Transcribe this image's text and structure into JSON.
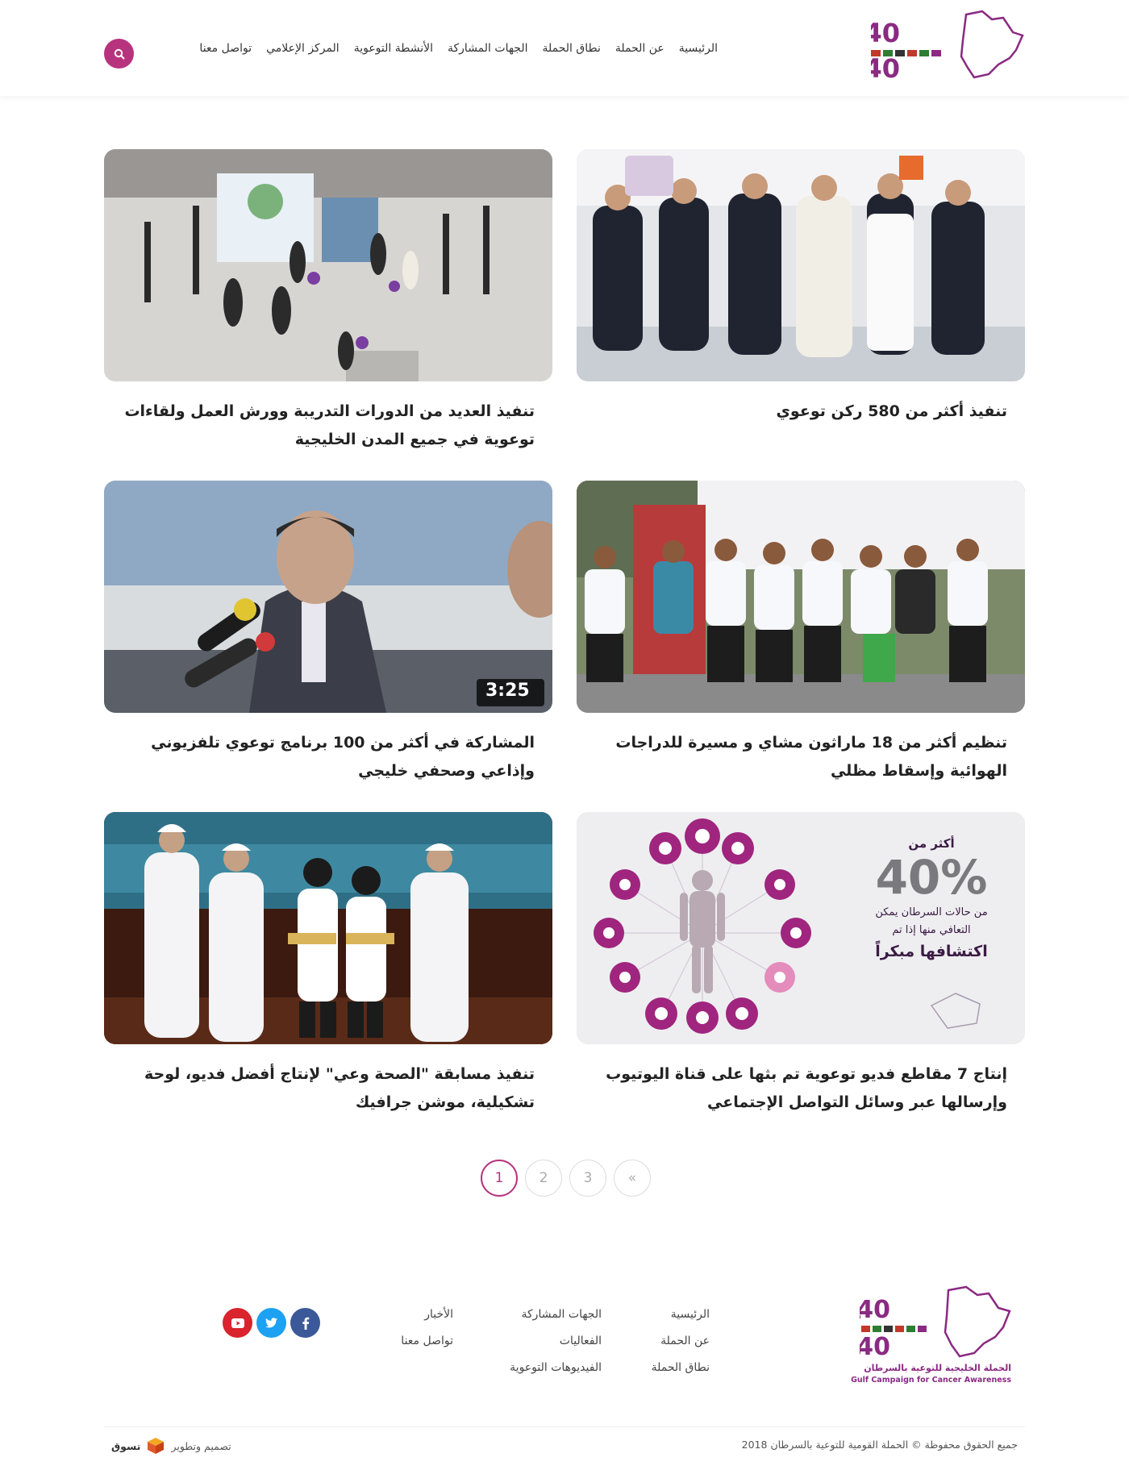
{
  "header": {
    "logo_alt": "40 وقاية 40 شفاء",
    "nav": [
      "الرئيسية",
      "عن الحملة",
      "نطاق الحملة",
      "الجهات المشاركة",
      "الأنشطة التوعوية",
      "المركز الإعلامي",
      "تواصل معنا"
    ]
  },
  "cards": [
    {
      "title": "تنفيذ أكثر من 580 ركن توعوي"
    },
    {
      "title": "تنفيذ العديد من الدورات التدريبة وورش العمل ولقاءات توعوية في جميع المدن الخليجية"
    },
    {
      "title": "تنظيم أكثر من 18 ماراثون مشاي و مسيرة للدراجات الهوائية وإسقاط مظلي"
    },
    {
      "title": "المشاركة في أكثر من 100 برنامج توعوي تلفزيوني وإذاعي وصحفي خليجي",
      "video_duration": "3:25"
    },
    {
      "title": "إنتاج 7 مقاطع فديو توعوية تم بثها على قناة اليوتيوب وإرسالها عبر وسائل التواصل الإجتماعي",
      "infographic": {
        "line1": "أكثر من",
        "percent": "40%",
        "line2": "من حالات السرطان يمكن",
        "line3": "التعافي منها إذا تم",
        "line4": "اكتشافها مبكراً"
      }
    },
    {
      "title": "تنفيذ مسابقة \"الصحة وعي\" لإنتاج أفضل فديو، لوحة تشكيلية، موشن جرافيك"
    }
  ],
  "pagination": {
    "pages": [
      "1",
      "2",
      "3"
    ],
    "next": "»",
    "active": "1"
  },
  "footer": {
    "logo_ar": "الحملة الخليجية للتوعية بالسرطان",
    "logo_en": "Gulf Campaign for Cancer Awareness",
    "col1": [
      "الرئيسية",
      "عن الحملة",
      "نطاق الحملة"
    ],
    "col2": [
      "الجهات المشاركة",
      "الفعاليات",
      "الفيديوهات التوعوية"
    ],
    "col3": [
      "الأخبار",
      "تواصل معنا"
    ],
    "copyright": "جميع الحقوق محفوظة © الحملة القومية للتوعية بالسرطان 2018",
    "credit_label": "تصميم وتطوير",
    "credit_brand": "تسوق"
  },
  "colors": {
    "brand": "#b8337e",
    "facebook": "#3b5998",
    "twitter": "#1da1f2",
    "youtube": "#d9232d"
  },
  "icons": [
    "search-icon",
    "facebook-icon",
    "twitter-icon",
    "youtube-icon"
  ]
}
